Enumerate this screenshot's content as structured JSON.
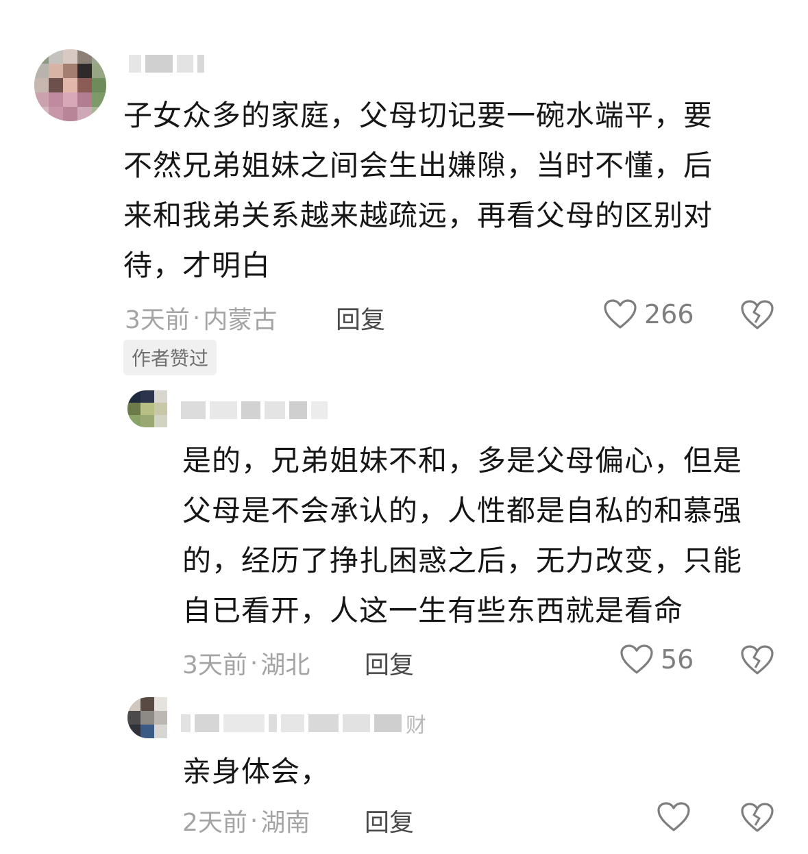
{
  "comments": [
    {
      "text_lines": [
        "子女众多的家庭，父母切记要一碗水端平，要",
        "不然兄弟姐妹之间会生出嫌隙，当时不懂，后",
        "来和我弟关系越来越疏远，再看父母的区别对",
        "待，才明白"
      ],
      "time": "3天前",
      "separator": "·",
      "location": "内蒙古",
      "reply_label": "回复",
      "likes": "266",
      "badge": "作者赞过"
    },
    {
      "text_lines": [
        "是的，兄弟姐妹不和，多是父母偏心，但是",
        "父母是不会承认的，人性都是自私的和慕强",
        "的，经历了挣扎困惑之后，无力改变，只能",
        "自已看开，人这一生有些东西就是看命"
      ],
      "time": "3天前",
      "separator": "·",
      "location": "湖北",
      "reply_label": "回复",
      "likes": "56"
    },
    {
      "name_suffix": "财",
      "text_lines": [
        "亲身体会，"
      ],
      "time": "2天前",
      "separator": "·",
      "location": "湖南",
      "reply_label": "回复",
      "likes": ""
    }
  ],
  "icons": {
    "like": "heart-outline-icon",
    "dislike": "broken-heart-icon"
  },
  "colors": {
    "text": "#161616",
    "meta": "#a4a4a4",
    "reply": "#4a4a4a",
    "badge_bg": "#f0f0f0"
  }
}
